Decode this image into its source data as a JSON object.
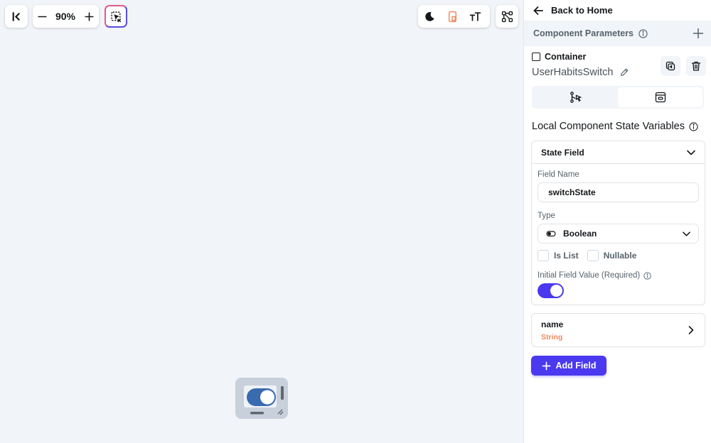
{
  "toolbar": {
    "zoom_value": "90%",
    "icons": [
      "collapse-left-icon",
      "zoom-out-icon",
      "zoom-in-icon",
      "highlight-toggle-icon",
      "dark-mode-icon",
      "device-preview-icon",
      "text-scale-icon",
      "widget-tree-icon"
    ]
  },
  "panel": {
    "back_label": "Back to Home",
    "params_label": "Component Parameters",
    "component_type": "Container",
    "component_name": "UserHabitsSwitch",
    "section_title": "Local Component State Variables",
    "state_field": {
      "header": "State Field",
      "field_name_label": "Field Name",
      "field_name_value": "switchState",
      "type_label": "Type",
      "type_value": "Boolean",
      "is_list_label": "Is List",
      "nullable_label": "Nullable",
      "initial_value_label": "Initial Field Value (Required)",
      "initial_value": true
    },
    "second_field": {
      "name": "name",
      "type": "String"
    },
    "add_field_label": "Add Field"
  },
  "colors": {
    "accent": "#4b39ef",
    "string_type": "#ee8b60",
    "canvas_bg": "#f1f4f8",
    "highlight_border": "#5b4ce0"
  }
}
